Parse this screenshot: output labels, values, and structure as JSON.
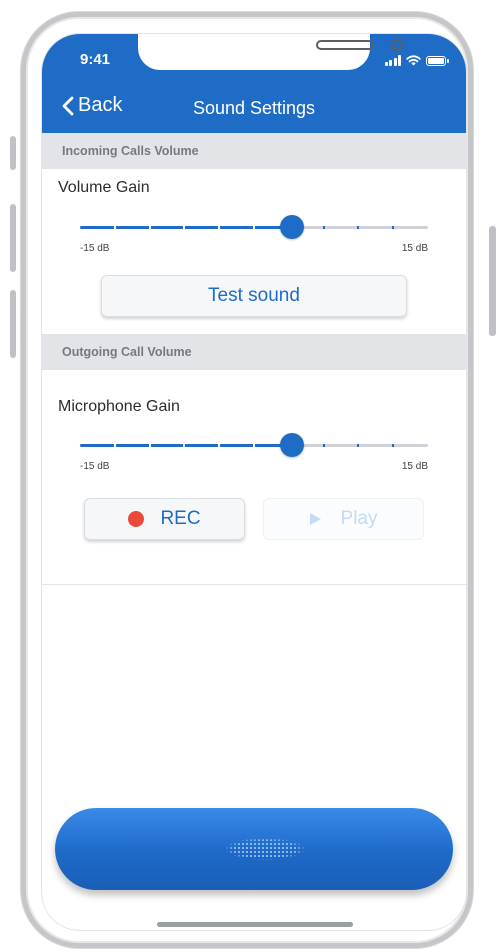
{
  "status": {
    "time": "9:41"
  },
  "nav": {
    "back_label": "Back",
    "title": "Sound Settings"
  },
  "incoming": {
    "section_title": "Incoming Calls Volume",
    "label": "Volume Gain",
    "slider_value_fraction": 0.61,
    "min_label": "-15 dB",
    "max_label": "15 dB",
    "test_button": "Test sound"
  },
  "outgoing": {
    "section_title": "Outgoing Call Volume",
    "label": "Microphone Gain",
    "slider_value_fraction": 0.61,
    "min_label": "-15 dB",
    "max_label": "15 dB",
    "rec_button": "REC",
    "play_button": "Play"
  },
  "colors": {
    "accent": "#1f6cc7",
    "record": "#ea4a3a",
    "section_bg": "#e2e4e7"
  },
  "icons": [
    "back-chevron-icon",
    "signal-icon",
    "wifi-icon",
    "battery-icon",
    "record-dot-icon",
    "play-icon",
    "speaker-grille-icon"
  ]
}
